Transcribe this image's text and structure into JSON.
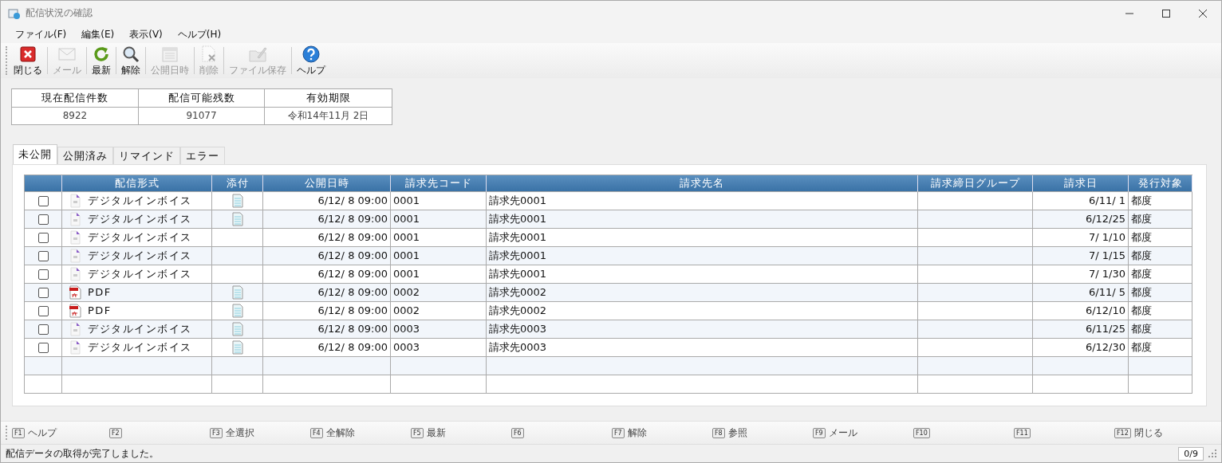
{
  "window": {
    "title": "配信状況の確認"
  },
  "menu": [
    {
      "label": "ファイル(F)"
    },
    {
      "label": "編集(E)"
    },
    {
      "label": "表示(V)"
    },
    {
      "label": "ヘルプ(H)"
    }
  ],
  "toolbar": [
    {
      "kind": "close",
      "label": "閉じる",
      "disabled": false
    },
    {
      "kind": "mail",
      "label": "メール",
      "disabled": true
    },
    {
      "kind": "refresh",
      "label": "最新",
      "disabled": false
    },
    {
      "kind": "search",
      "label": "解除",
      "disabled": false
    },
    {
      "kind": "calendar",
      "label": "公開日時",
      "disabled": true
    },
    {
      "kind": "delete",
      "label": "削除",
      "disabled": true
    },
    {
      "kind": "save",
      "label": "ファイル保存",
      "disabled": true
    },
    {
      "kind": "help",
      "label": "ヘルプ",
      "disabled": false
    }
  ],
  "summary": {
    "columns": [
      "現在配信件数",
      "配信可能残数",
      "有効期限"
    ],
    "values": [
      "8922",
      "91077",
      "令和14年11月 2日"
    ]
  },
  "tabs": [
    {
      "label": "未公開",
      "selected": true
    },
    {
      "label": "公開済み",
      "selected": false
    },
    {
      "label": "リマインド",
      "selected": false
    },
    {
      "label": "エラー",
      "selected": false
    }
  ],
  "table": {
    "columns": [
      "配信形式",
      "添付",
      "公開日時",
      "請求先コード",
      "請求先名",
      "請求締日グループ",
      "請求日",
      "発行対象"
    ],
    "rows": [
      {
        "checked": false,
        "kind": "digital",
        "format": "デジタルインボイス",
        "attachment": true,
        "published": "6/12/ 8 09:00",
        "code": "0001",
        "name": "請求先0001",
        "date": "6/11/ 1",
        "target": "都度"
      },
      {
        "checked": false,
        "kind": "digital",
        "format": "デジタルインボイス",
        "attachment": true,
        "published": "6/12/ 8 09:00",
        "code": "0001",
        "name": "請求先0001",
        "date": "6/12/25",
        "target": "都度"
      },
      {
        "checked": false,
        "kind": "digital",
        "format": "デジタルインボイス",
        "attachment": false,
        "published": "6/12/ 8 09:00",
        "code": "0001",
        "name": "請求先0001",
        "date": "7/ 1/10",
        "target": "都度"
      },
      {
        "checked": false,
        "kind": "digital",
        "format": "デジタルインボイス",
        "attachment": false,
        "published": "6/12/ 8 09:00",
        "code": "0001",
        "name": "請求先0001",
        "date": "7/ 1/15",
        "target": "都度"
      },
      {
        "checked": false,
        "kind": "digital",
        "format": "デジタルインボイス",
        "attachment": false,
        "published": "6/12/ 8 09:00",
        "code": "0001",
        "name": "請求先0001",
        "date": "7/ 1/30",
        "target": "都度"
      },
      {
        "checked": false,
        "kind": "pdf",
        "format": "PDF",
        "attachment": true,
        "published": "6/12/ 8 09:00",
        "code": "0002",
        "name": "請求先0002",
        "date": "6/11/ 5",
        "target": "都度"
      },
      {
        "checked": false,
        "kind": "pdf",
        "format": "PDF",
        "attachment": true,
        "published": "6/12/ 8 09:00",
        "code": "0002",
        "name": "請求先0002",
        "date": "6/12/10",
        "target": "都度"
      },
      {
        "checked": false,
        "kind": "digital",
        "format": "デジタルインボイス",
        "attachment": true,
        "published": "6/12/ 8 09:00",
        "code": "0003",
        "name": "請求先0003",
        "date": "6/11/25",
        "target": "都度"
      },
      {
        "checked": false,
        "kind": "digital",
        "format": "デジタルインボイス",
        "attachment": true,
        "published": "6/12/ 8 09:00",
        "code": "0003",
        "name": "請求先0003",
        "date": "6/12/30",
        "target": "都度"
      }
    ]
  },
  "function_keys": [
    {
      "key": "F1",
      "label": "ヘルプ"
    },
    {
      "key": "F2"
    },
    {
      "key": "F3",
      "label": "全選択"
    },
    {
      "key": "F4",
      "label": "全解除"
    },
    {
      "key": "F5",
      "label": "最新"
    },
    {
      "key": "F6"
    },
    {
      "key": "F7",
      "label": "解除"
    },
    {
      "key": "F8",
      "label": "参照"
    },
    {
      "key": "F9",
      "label": "メール"
    },
    {
      "key": "F10"
    },
    {
      "key": "F11"
    },
    {
      "key": "F12",
      "label": "閉じる"
    }
  ],
  "status_bar": {
    "message": "配信データの取得が完了しました。",
    "count": "0/9"
  }
}
